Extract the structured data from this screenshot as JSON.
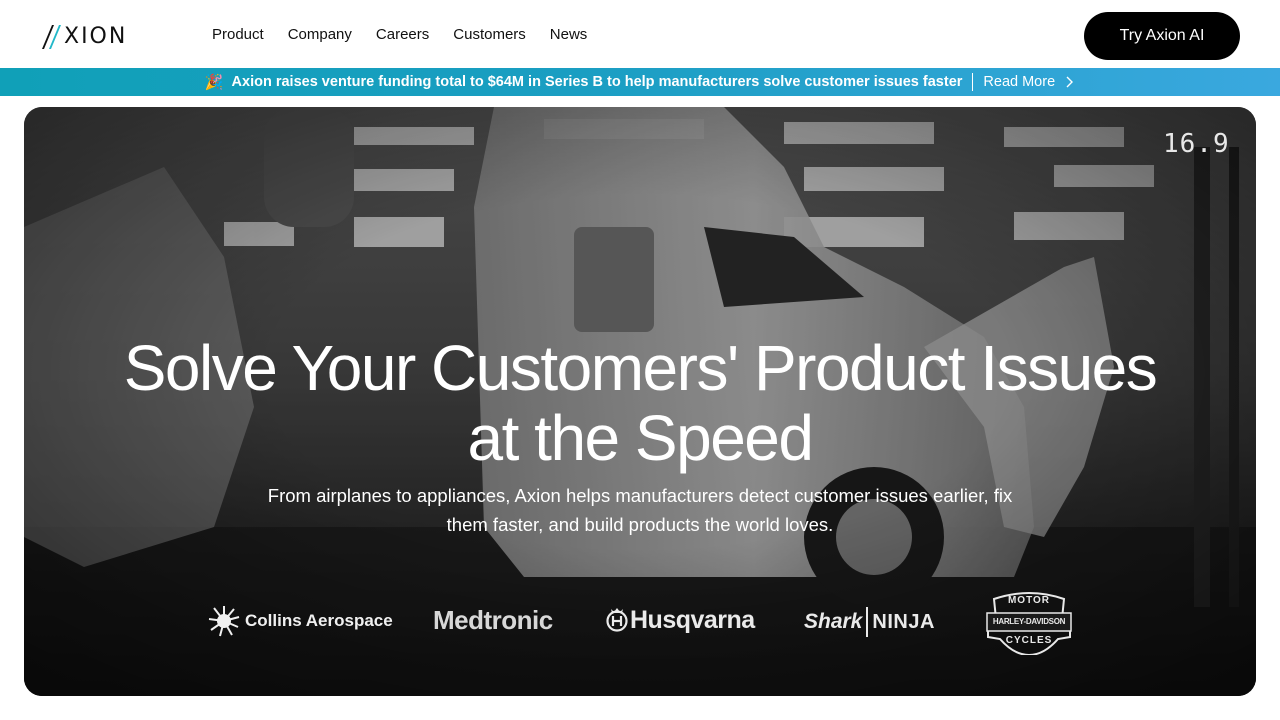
{
  "header": {
    "logo_text": "XION",
    "nav": [
      "Product",
      "Company",
      "Careers",
      "Customers",
      "News"
    ],
    "cta_label": "Try Axion AI"
  },
  "banner": {
    "emoji": "🎉",
    "text": "Axion raises venture funding total to $64M in Series B to help manufacturers solve customer issues faster",
    "link_label": "Read More"
  },
  "hero": {
    "title_line1": "Solve Your Customers' Product Issues",
    "title_line2": "at the Speed",
    "subtitle": "From airplanes to appliances, Axion helps manufacturers detect customer issues earlier, fix them faster, and build products the world loves.",
    "overlay_number": "16.9",
    "logos": {
      "collins": "Collins Aerospace",
      "medtronic": "Medtronic",
      "husqvarna": "Husqvarna",
      "shark": "Shark",
      "ninja": "NINJA",
      "harley_top": "MOTOR",
      "harley_mid": "HARLEY-DAVIDSON",
      "harley_bottom": "CYCLES"
    }
  },
  "colors": {
    "banner_start": "#10a0b8",
    "banner_end": "#3aa8df",
    "cta_bg": "#000000",
    "logo_accent": "#22b8c9"
  }
}
